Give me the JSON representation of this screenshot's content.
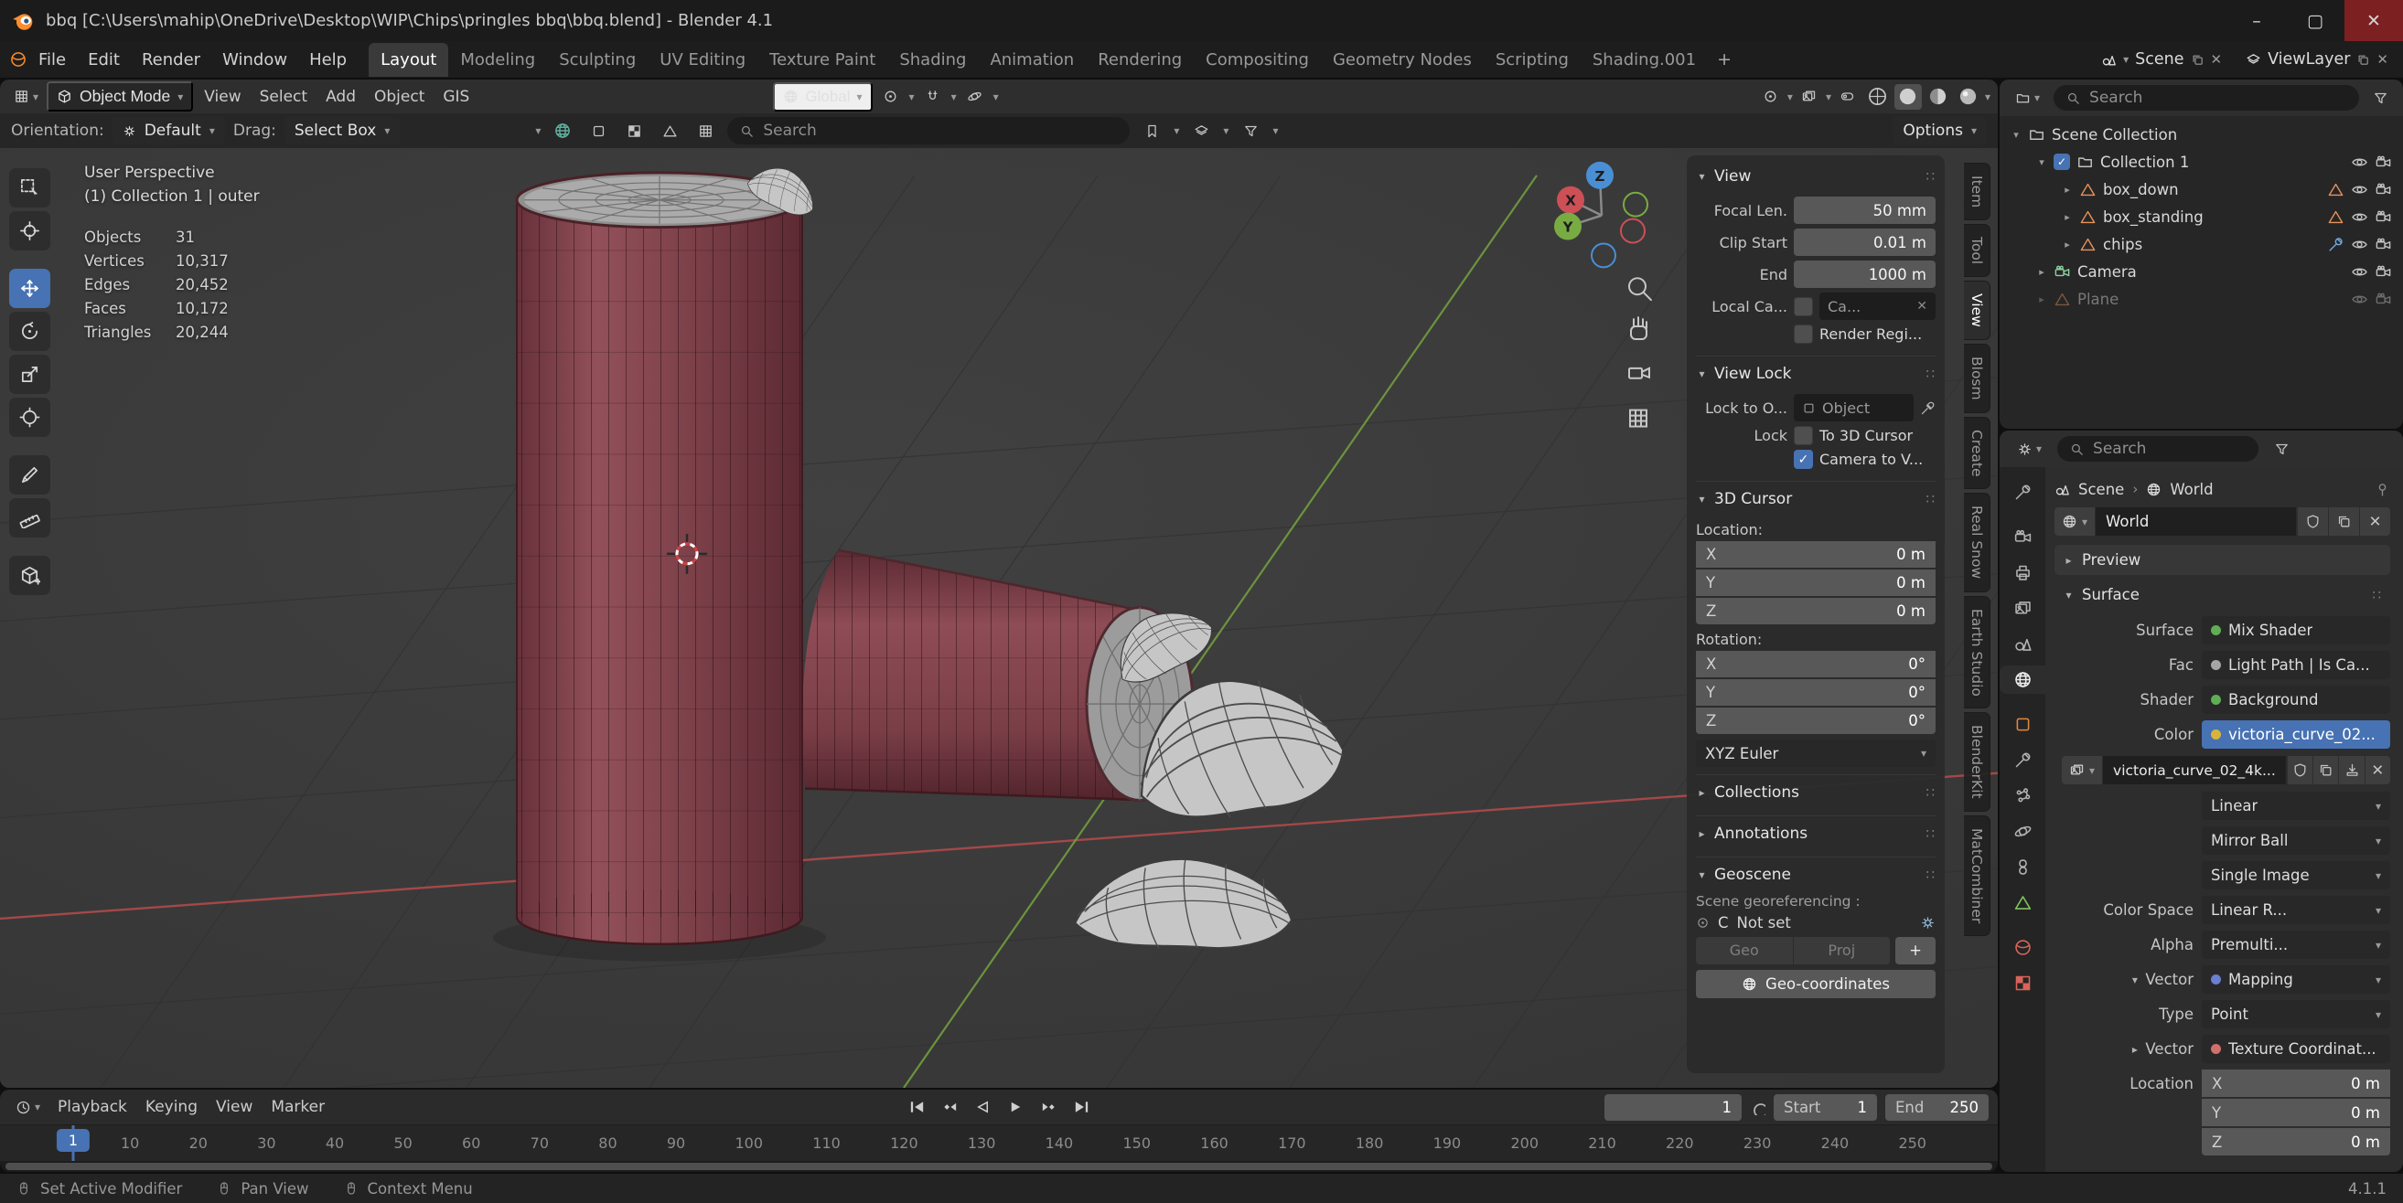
{
  "colors": {
    "accent_blue": "#4772b3",
    "can_red": "#8a474d",
    "axis_x_red": "#b04a4a",
    "axis_y_green": "#76a33f",
    "axis_z_blue": "#3b82c4"
  },
  "window": {
    "title": "bbq [C:\\Users\\mahip\\OneDrive\\Desktop\\WIP\\Chips\\pringles bbq\\bbq.blend] - Blender 4.1"
  },
  "topbar": {
    "menus": [
      "File",
      "Edit",
      "Render",
      "Window",
      "Help"
    ],
    "workspaces": [
      "Layout",
      "Modeling",
      "Sculpting",
      "UV Editing",
      "Texture Paint",
      "Shading",
      "Animation",
      "Rendering",
      "Compositing",
      "Geometry Nodes",
      "Scripting",
      "Shading.001"
    ],
    "active_workspace": "Layout",
    "add_tab": "+",
    "scene": "Scene",
    "viewlayer": "ViewLayer"
  },
  "viewport_header": {
    "mode": "Object Mode",
    "menus": [
      "View",
      "Select",
      "Add",
      "Object",
      "GIS"
    ],
    "orientation": "Global"
  },
  "tool_settings": {
    "orientation_label": "Orientation:",
    "orientation_value": "Default",
    "drag_label": "Drag:",
    "drag_value": "Select Box",
    "search_placeholder": "Search",
    "options": "Options"
  },
  "overlay": {
    "perspective": "User Perspective",
    "collection": "(1) Collection 1 | outer",
    "stats": [
      {
        "label": "Objects",
        "value": "31"
      },
      {
        "label": "Vertices",
        "value": "10,317"
      },
      {
        "label": "Edges",
        "value": "20,452"
      },
      {
        "label": "Faces",
        "value": "10,172"
      },
      {
        "label": "Triangles",
        "value": "20,244"
      }
    ]
  },
  "gizmo": {
    "x": "X",
    "y": "Y",
    "z": "Z"
  },
  "npanel": {
    "tabs": [
      "Item",
      "Tool",
      "View",
      "Blosm",
      "Create",
      "Real Snow",
      "Earth Studio",
      "BlenderKit",
      "MatCombiner"
    ],
    "active_tab": "View",
    "view_title": "View",
    "focal": {
      "label": "Focal Len.",
      "value": "50 mm"
    },
    "clip_start": {
      "label": "Clip Start",
      "value": "0.01 m"
    },
    "clip_end": {
      "label": "End",
      "value": "1000 m"
    },
    "local_camera": {
      "label": "Local Ca...",
      "value": "Ca..."
    },
    "render_region_label": "Render Regi...",
    "view_lock_title": "View Lock",
    "lock_to": {
      "label": "Lock to O...",
      "value": "Object"
    },
    "lock_label": "Lock",
    "to_3d_cursor": "To 3D Cursor",
    "camera_to_view": "Camera to V...",
    "cursor_title": "3D Cursor",
    "location_label": "Location:",
    "rotation_label": "Rotation:",
    "cursor_location": [
      {
        "axis": "X",
        "value": "0 m"
      },
      {
        "axis": "Y",
        "value": "0 m"
      },
      {
        "axis": "Z",
        "value": "0 m"
      }
    ],
    "cursor_rotation": [
      {
        "axis": "X",
        "value": "0°"
      },
      {
        "axis": "Y",
        "value": "0°"
      },
      {
        "axis": "Z",
        "value": "0°"
      }
    ],
    "euler": "XYZ Euler",
    "collections_title": "Collections",
    "annotations_title": "Annotations",
    "geoscene_title": "Geoscene",
    "georef_label": "Scene georeferencing :",
    "crs_letter": "C",
    "crs_value": "Not set",
    "geo_btn": "Geo",
    "proj_btn": "Proj",
    "add_btn": "+",
    "geo_coords_btn": "Geo-coordinates"
  },
  "outliner": {
    "search_placeholder": "Search",
    "rows": [
      {
        "label": "Scene Collection"
      },
      {
        "label": "Collection 1"
      },
      {
        "label": "box_down"
      },
      {
        "label": "box_standing"
      },
      {
        "label": "chips"
      },
      {
        "label": "Camera"
      },
      {
        "label": "Plane"
      }
    ]
  },
  "properties": {
    "search_placeholder": "Search",
    "breadcrumb_scene": "Scene",
    "breadcrumb_world": "World",
    "world_name": "World",
    "preview_title": "Preview",
    "surface_title": "Surface",
    "shader_rows": [
      {
        "label": "Surface",
        "value": "Mix Shader"
      },
      {
        "label": "Fac",
        "value": "Light Path | Is Ca..."
      },
      {
        "label": "Shader",
        "value": "Background"
      },
      {
        "label": "Color",
        "value": "victoria_curve_02..."
      }
    ],
    "image_name": "victoria_curve_02_4k...",
    "interpolation": "Linear",
    "projection": "Mirror Ball",
    "source": "Single Image",
    "color_space_label": "Color Space",
    "color_space_value": "Linear R...",
    "alpha_label": "Alpha",
    "alpha_value": "Premulti...",
    "vector_label": "Vector",
    "vector_value": "Mapping",
    "type_label": "Type",
    "type_value": "Point",
    "vector2_label": "Vector",
    "vector2_value": "Texture Coordinat...",
    "location_label": "Location",
    "location": [
      {
        "axis": "X",
        "value": "0 m"
      },
      {
        "axis": "Y",
        "value": "0 m"
      },
      {
        "axis": "Z",
        "value": "0 m"
      }
    ]
  },
  "timeline": {
    "menus": [
      "Playback",
      "Keying",
      "View",
      "Marker"
    ],
    "current_frame": "1",
    "start_label": "Start",
    "start_value": "1",
    "end_label": "End",
    "end_value": "250",
    "ticks": [
      "10",
      "20",
      "30",
      "40",
      "50",
      "60",
      "70",
      "80",
      "90",
      "100",
      "110",
      "120",
      "130",
      "140",
      "150",
      "160",
      "170",
      "180",
      "190",
      "200",
      "210",
      "220",
      "230",
      "240",
      "250"
    ]
  },
  "statusbar": {
    "items": [
      "Set Active Modifier",
      "Pan View",
      "Context Menu"
    ],
    "version": "4.1.1"
  }
}
